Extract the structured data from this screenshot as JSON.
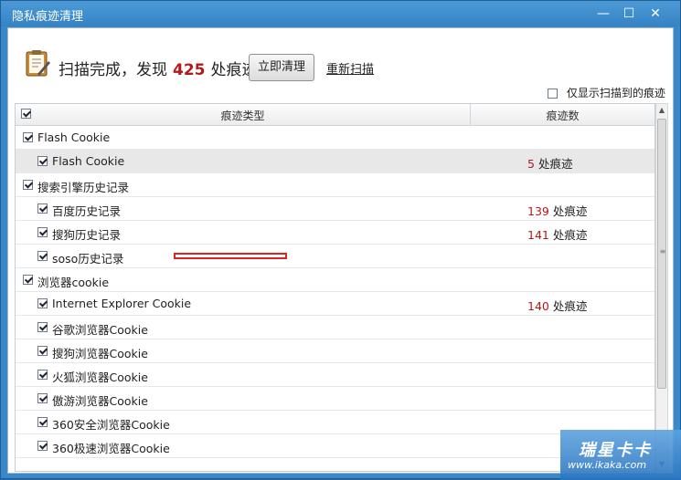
{
  "window": {
    "title": "隐私痕迹清理",
    "minimize": "—",
    "maximize": "☐",
    "close": "✕"
  },
  "header": {
    "summary_prefix": "扫描完成，发现",
    "summary_count": "425",
    "summary_suffix": "处痕迹",
    "clean_button": "立即清理",
    "rescan_link": "重新扫描"
  },
  "filter": {
    "label": "仅显示扫描到的痕迹",
    "checked": false
  },
  "table": {
    "col_type": "痕迹类型",
    "col_count": "痕迹数",
    "rows": [
      {
        "level": 0,
        "label": "Flash Cookie",
        "count": "",
        "unit": "",
        "checked": true,
        "selected": false
      },
      {
        "level": 1,
        "label": "Flash Cookie",
        "count": "5",
        "unit": "处痕迹",
        "checked": true,
        "selected": true
      },
      {
        "level": 0,
        "label": "搜索引擎历史记录",
        "count": "",
        "unit": "",
        "checked": true,
        "selected": false
      },
      {
        "level": 1,
        "label": "百度历史记录",
        "count": "139",
        "unit": "处痕迹",
        "checked": true,
        "selected": false
      },
      {
        "level": 1,
        "label": "搜狗历史记录",
        "count": "141",
        "unit": "处痕迹",
        "checked": true,
        "selected": false
      },
      {
        "level": 1,
        "label": "soso历史记录",
        "count": "",
        "unit": "",
        "checked": true,
        "selected": false,
        "highlight": true
      },
      {
        "level": 0,
        "label": "浏览器cookie",
        "count": "",
        "unit": "",
        "checked": true,
        "selected": false
      },
      {
        "level": 1,
        "label": "Internet Explorer Cookie",
        "count": "140",
        "unit": "处痕迹",
        "checked": true,
        "selected": false
      },
      {
        "level": 1,
        "label": "谷歌浏览器Cookie",
        "count": "",
        "unit": "",
        "checked": true,
        "selected": false
      },
      {
        "level": 1,
        "label": "搜狗浏览器Cookie",
        "count": "",
        "unit": "",
        "checked": true,
        "selected": false
      },
      {
        "level": 1,
        "label": "火狐浏览器Cookie",
        "count": "",
        "unit": "",
        "checked": true,
        "selected": false
      },
      {
        "level": 1,
        "label": "傲游浏览器Cookie",
        "count": "",
        "unit": "",
        "checked": true,
        "selected": false
      },
      {
        "level": 1,
        "label": "360安全浏览器Cookie",
        "count": "",
        "unit": "",
        "checked": true,
        "selected": false
      },
      {
        "level": 1,
        "label": "360极速浏览器Cookie",
        "count": "",
        "unit": "",
        "checked": true,
        "selected": false
      }
    ]
  },
  "watermark": {
    "main": "瑞星卡卡",
    "sub": "www.ikaka.com"
  },
  "colors": {
    "accent": "#3b88c8",
    "count_red": "#b11a1a",
    "highlight_box": "#dd2222"
  }
}
